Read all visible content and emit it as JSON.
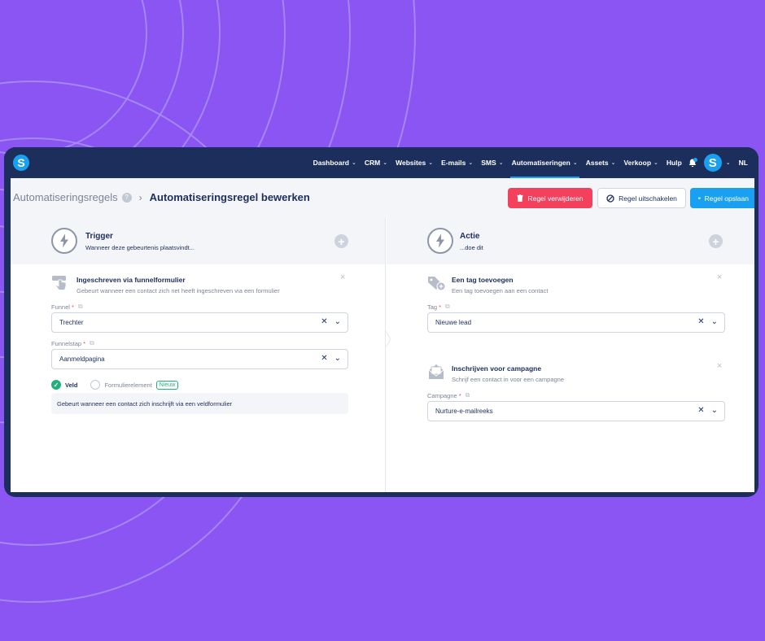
{
  "colors": {
    "background": "#8a55f2",
    "nav": "#1c2e5c",
    "accent": "#1aa0f0",
    "danger": "#f3415d",
    "success": "#21b07c"
  },
  "nav": {
    "logo": "S",
    "items": [
      {
        "label": "Dashboard",
        "chevron": "⌄"
      },
      {
        "label": "CRM",
        "chevron": "⌄"
      },
      {
        "label": "Websites",
        "chevron": "⌄"
      },
      {
        "label": "E-mails",
        "chevron": "⌄"
      },
      {
        "label": "SMS",
        "chevron": "⌄"
      },
      {
        "label": "Automatiseringen",
        "chevron": "⌄",
        "active": true
      },
      {
        "label": "Assets",
        "chevron": "⌄"
      },
      {
        "label": "Verkoop",
        "chevron": "⌄"
      },
      {
        "label": "Hulp"
      }
    ],
    "bell_icon": "bell-icon",
    "avatar": "S",
    "language": "NL"
  },
  "header": {
    "breadcrumb_parent": "Automatiseringsregels",
    "help_icon": "?",
    "separator": "›",
    "title": "Automatiseringsregel bewerken",
    "delete_label": "Regel verwijderen",
    "disable_label": "Regel uitschakelen",
    "save_label": "Regel opslaan"
  },
  "trigger": {
    "title": "Trigger",
    "subtitle": "Wanneer deze gebeurtenis plaatsvindt...",
    "add": "+",
    "item": {
      "title": "Ingeschreven via funnelformulier",
      "subtitle": "Gebeurt wanneer een contact zich net heeft ingeschreven via een formulier",
      "close": "×"
    },
    "fields": [
      {
        "label": "Funnel",
        "required": "*",
        "value": "Trechter"
      },
      {
        "label": "Funnelstap",
        "required": "*",
        "value": "Aanmeldpagina"
      }
    ],
    "tabs": {
      "veld": "Veld",
      "formulierelement": "Formulierelement",
      "badge": "Nieuw"
    },
    "info": "Gebeurt wanneer een contact zich inschrijft via een veldformulier"
  },
  "action": {
    "title": "Actie",
    "subtitle": "...doe dit",
    "add": "+",
    "items": [
      {
        "title": "Een tag toevoegen",
        "subtitle": "Een tag toevoegen aan een contact",
        "close": "×",
        "field": {
          "label": "Tag",
          "required": "*",
          "value": "Nieuwe lead"
        }
      },
      {
        "title": "Inschrijven voor campagne",
        "subtitle": "Schrijf een contact in voor een campagne",
        "close": "×",
        "field": {
          "label": "Campagne",
          "required": "*",
          "value": "Nurture-e-mailreeks"
        }
      }
    ]
  },
  "select_controls": {
    "clear": "✕",
    "open": "⌄"
  },
  "icons": {
    "external": "external-link-icon",
    "bolt": "lightning-icon"
  }
}
